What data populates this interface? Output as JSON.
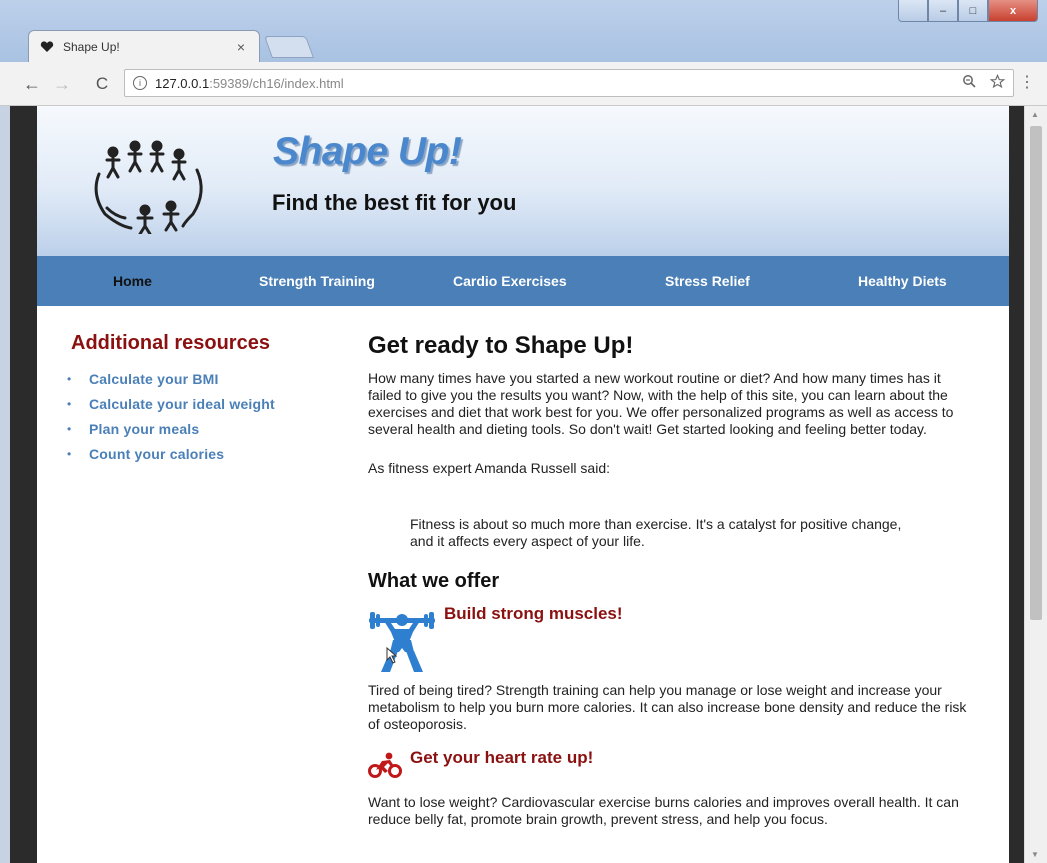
{
  "browser": {
    "tab_title": "Shape Up!",
    "tab_close": "×",
    "url_host": "127.0.0.1",
    "url_rest": ":59389/ch16/index.html",
    "back_icon": "←",
    "forward_icon": "→",
    "reload_icon": "C",
    "menu_icon": "⋮"
  },
  "window_controls": {
    "minimize": "–",
    "maximize": "□",
    "close": "x"
  },
  "site": {
    "title": "Shape Up!",
    "tagline": "Find the best fit for you"
  },
  "nav": {
    "items": [
      {
        "label": "Home"
      },
      {
        "label": "Strength Training"
      },
      {
        "label": "Cardio Exercises"
      },
      {
        "label": "Stress Relief"
      },
      {
        "label": "Healthy Diets"
      }
    ]
  },
  "sidebar": {
    "title": "Additional resources",
    "links": [
      {
        "label": "Calculate your BMI"
      },
      {
        "label": "Calculate your ideal weight"
      },
      {
        "label": "Plan your meals"
      },
      {
        "label": "Count your calories"
      }
    ]
  },
  "main": {
    "title": "Get ready to Shape Up!",
    "intro": "How many times have you started a new workout routine or diet? And how many times has it failed to give you the results you want? Now, with the help of this site, you can learn about the exercises and diet that work best for you. We offer personalized programs as well as access to several health and dieting tools. So don't wait! Get started looking and feeling better today.",
    "quote_intro": "As fitness expert Amanda Russell said:",
    "quote": "Fitness is about so much more than exercise. It's a catalyst for positive change, and it affects every aspect of your life.",
    "offer_title": "What we offer",
    "features": [
      {
        "title": "Build strong muscles!",
        "text": "Tired of being tired? Strength training can help you manage or lose weight and increase your metabolism to help you burn more calories. It can also increase bone density and reduce the risk of osteoporosis.",
        "icon": "weightlifter-icon"
      },
      {
        "title": "Get your heart rate up!",
        "text": "Want to lose weight? Cardiovascular exercise burns calories and improves overall health. It can reduce belly fat, promote brain growth, prevent stress, and help you focus.",
        "icon": "cyclist-icon"
      }
    ]
  },
  "colors": {
    "brand_blue": "#4a87cc",
    "nav_blue": "#4a7fb7",
    "heading_red": "#8b1111"
  }
}
